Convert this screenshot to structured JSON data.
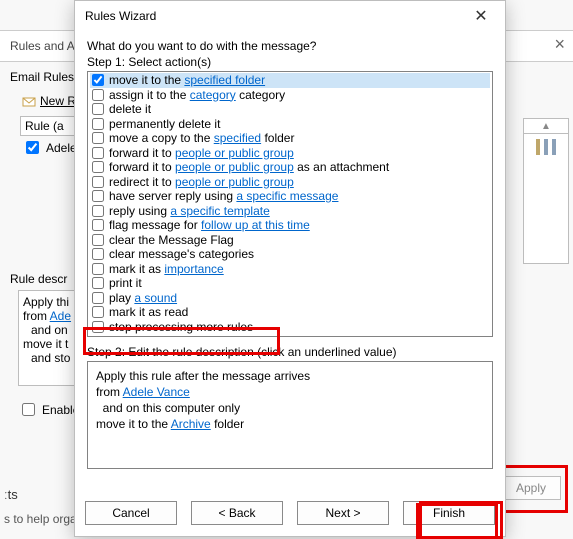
{
  "under": {
    "tab": "Rules and A",
    "email_rules": "Email Rules",
    "new_rule": "New R",
    "rule_header": "Rule (a",
    "rule_item": "Adele",
    "rule_desc_label": "Rule descr",
    "desc_lines": [
      "Apply thi",
      "from",
      "and on",
      "move it t",
      "and sto"
    ],
    "desc_link": "Ade",
    "enable": "Enable",
    "help": "s to help orga",
    "ts": "ːts",
    "apply": "Apply"
  },
  "dialog": {
    "title": "Rules Wizard",
    "prompt": "What do you want to do with the message?",
    "step1": "Step 1: Select action(s)",
    "actions": [
      {
        "pre": "move it to the ",
        "link": "specified folder",
        "post": "",
        "checked": true,
        "selected": true
      },
      {
        "pre": "assign it to the ",
        "link": "category",
        "post": " category",
        "checked": false
      },
      {
        "pre": "delete it",
        "link": "",
        "post": "",
        "checked": false
      },
      {
        "pre": "permanently delete it",
        "link": "",
        "post": "",
        "checked": false
      },
      {
        "pre": "move a copy to the ",
        "link": "specified",
        "post": " folder",
        "checked": false
      },
      {
        "pre": "forward it to ",
        "link": "people or public group",
        "post": "",
        "checked": false
      },
      {
        "pre": "forward it to ",
        "link": "people or public group",
        "post": " as an attachment",
        "checked": false
      },
      {
        "pre": "redirect it to ",
        "link": "people or public group",
        "post": "",
        "checked": false
      },
      {
        "pre": "have server reply using ",
        "link": "a specific message",
        "post": "",
        "checked": false
      },
      {
        "pre": "reply using ",
        "link": "a specific template",
        "post": "",
        "checked": false
      },
      {
        "pre": "flag message for ",
        "link": "follow up at this time",
        "post": "",
        "checked": false
      },
      {
        "pre": "clear the Message Flag",
        "link": "",
        "post": "",
        "checked": false
      },
      {
        "pre": "clear message's categories",
        "link": "",
        "post": "",
        "checked": false
      },
      {
        "pre": "mark it as ",
        "link": "importance",
        "post": "",
        "checked": false
      },
      {
        "pre": "print it",
        "link": "",
        "post": "",
        "checked": false
      },
      {
        "pre": "play ",
        "link": "a sound",
        "post": "",
        "checked": false
      },
      {
        "pre": "mark it as read",
        "link": "",
        "post": "",
        "checked": false
      },
      {
        "pre": "stop processing more rules",
        "link": "",
        "post": "",
        "checked": false
      }
    ],
    "step2": "Step 2: Edit the rule description (click an underlined value)",
    "desc": {
      "l1": "Apply this rule after the message arrives",
      "l2a": "from ",
      "l2link": "Adele Vance",
      "l3": "  and on this computer only",
      "l4a": "move it to the ",
      "l4link": "Archive",
      "l4b": " folder"
    },
    "buttons": {
      "cancel": "Cancel",
      "back": "< Back",
      "next": "Next >",
      "finish": "Finish"
    }
  }
}
